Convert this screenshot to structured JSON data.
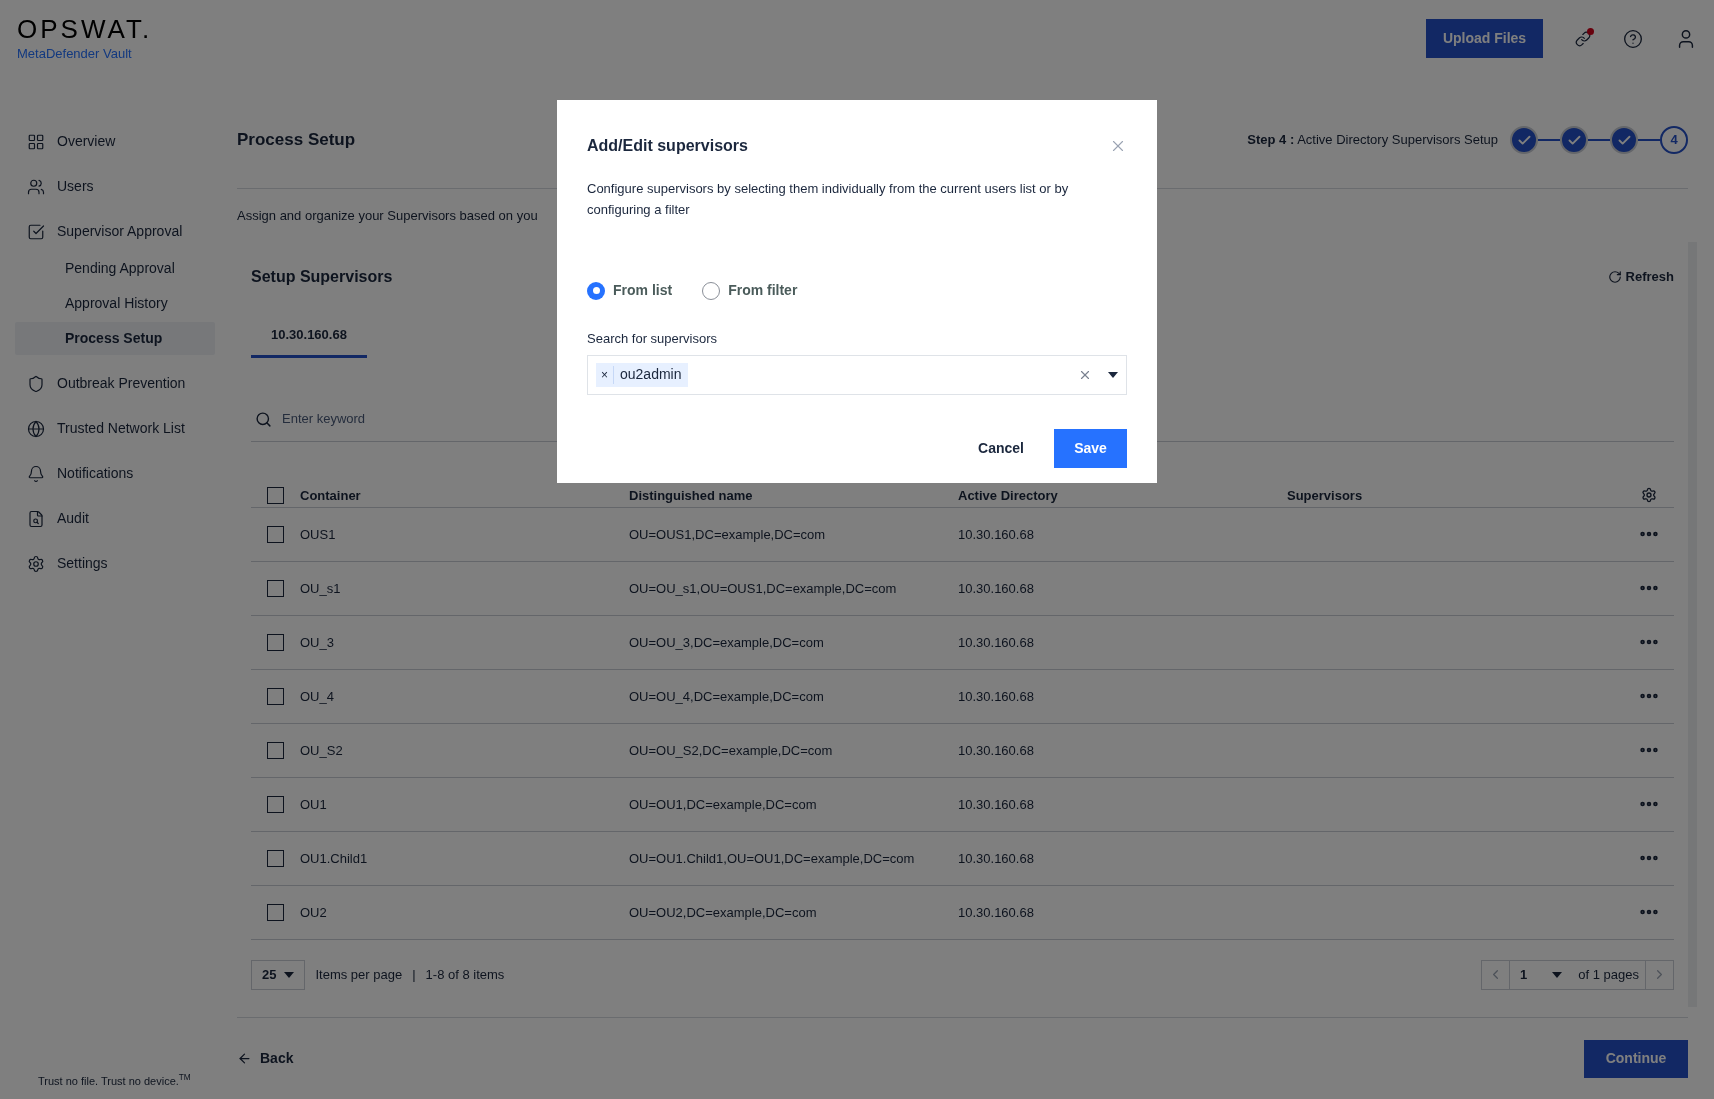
{
  "header": {
    "logo": "OPSWAT.",
    "product": "MetaDefender Vault",
    "upload_button": "Upload Files",
    "notification_dot": true
  },
  "sidebar": {
    "items": [
      {
        "label": "Overview",
        "selected": false
      },
      {
        "label": "Users",
        "selected": false
      },
      {
        "label": "Supervisor Approval",
        "selected": false,
        "children": [
          {
            "label": "Pending Approval",
            "selected": false
          },
          {
            "label": "Approval History",
            "selected": false
          },
          {
            "label": "Process Setup",
            "selected": true
          }
        ]
      },
      {
        "label": "Outbreak Prevention",
        "selected": false
      },
      {
        "label": "Trusted Network List",
        "selected": false
      },
      {
        "label": "Notifications",
        "selected": false
      },
      {
        "label": "Audit",
        "selected": false
      },
      {
        "label": "Settings",
        "selected": false
      }
    ],
    "footer": "Trust no file. Trust no device.$^{TM}$"
  },
  "page": {
    "title": "Process Setup",
    "step_label": "Step 4 :",
    "step_name": "Active Directory Supervisors Setup",
    "steps": [
      {
        "completed": true
      },
      {
        "completed": true
      },
      {
        "completed": true
      },
      {
        "completed": false,
        "number": "4"
      }
    ],
    "description": "Assign and organize your Supervisors based on you"
  },
  "section": {
    "title": "Setup Supervisors",
    "refresh": "Refresh",
    "tabs": [
      {
        "label": "10.30.160.68",
        "selected": true
      }
    ],
    "search": {
      "placeholder": "Enter keyword"
    }
  },
  "table": {
    "header_checked": false,
    "columns": [
      "Container",
      "Distinguished name",
      "Active Directory",
      "Supervisors"
    ],
    "rows": [
      {
        "checked": false,
        "cells": [
          "OUS1",
          "OU=OUS1,DC=example,DC=com",
          "10.30.160.68"
        ]
      },
      {
        "checked": false,
        "cells": [
          "OU_s1",
          "OU=OU_s1,OU=OUS1,DC=example,DC=com",
          "10.30.160.68"
        ]
      },
      {
        "checked": false,
        "cells": [
          "OU_3",
          "OU=OU_3,DC=example,DC=com",
          "10.30.160.68"
        ]
      },
      {
        "checked": false,
        "cells": [
          "OU_4",
          "OU=OU_4,DC=example,DC=com",
          "10.30.160.68"
        ]
      },
      {
        "checked": false,
        "cells": [
          "OU_S2",
          "OU=OU_S2,DC=example,DC=com",
          "10.30.160.68"
        ]
      },
      {
        "checked": false,
        "cells": [
          "OU1",
          "OU=OU1,DC=example,DC=com",
          "10.30.160.68"
        ]
      },
      {
        "checked": false,
        "cells": [
          "OU1.Child1",
          "OU=OU1.Child1,OU=OU1,DC=example,DC=com",
          "10.30.160.68"
        ]
      },
      {
        "checked": false,
        "cells": [
          "OU2",
          "OU=OU2,DC=example,DC=com",
          "10.30.160.68"
        ]
      }
    ]
  },
  "pagination": {
    "page_size": "25",
    "per_page_label": "Items per page",
    "separator": "|",
    "range": "1-8 of 8 items",
    "page": "1",
    "of_pages": "of 1 pages"
  },
  "footer_nav": {
    "back": "Back",
    "continue": "Continue"
  },
  "modal": {
    "title": "Add/Edit supervisors",
    "description": "Configure supervisors by selecting them individually from the current users list or by configuring a filter",
    "options": [
      {
        "label": "From list",
        "selected": true
      },
      {
        "label": "From filter",
        "selected": false
      }
    ],
    "field_label": "Search for supervisors",
    "tags": [
      {
        "label": "ou2admin",
        "remove": "×"
      }
    ],
    "buttons": [
      {
        "label": "Cancel",
        "kind": "secondary"
      },
      {
        "label": "Save",
        "kind": "primary"
      }
    ]
  }
}
